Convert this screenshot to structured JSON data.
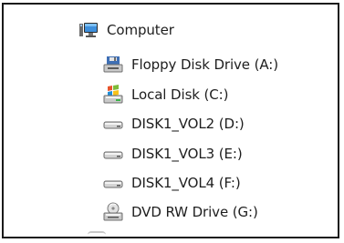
{
  "tree": {
    "root": {
      "label": "Computer",
      "icon": "computer-icon"
    },
    "drives": [
      {
        "label": "Floppy Disk Drive (A:)",
        "icon": "floppy-drive-icon"
      },
      {
        "label": "Local Disk (C:)",
        "icon": "windows-drive-icon"
      },
      {
        "label": "DISK1_VOL2 (D:)",
        "icon": "hard-drive-icon"
      },
      {
        "label": "DISK1_VOL3 (E:)",
        "icon": "hard-drive-icon"
      },
      {
        "label": "DISK1_VOL4 (F:)",
        "icon": "hard-drive-icon"
      },
      {
        "label": "DVD RW Drive (G:)",
        "icon": "dvd-drive-icon"
      }
    ]
  },
  "colors": {
    "text": "#1e1e1e",
    "border": "#1a1a1a",
    "drive_silver": "#c9c9c9",
    "drive_light": "#f2f2f2"
  }
}
